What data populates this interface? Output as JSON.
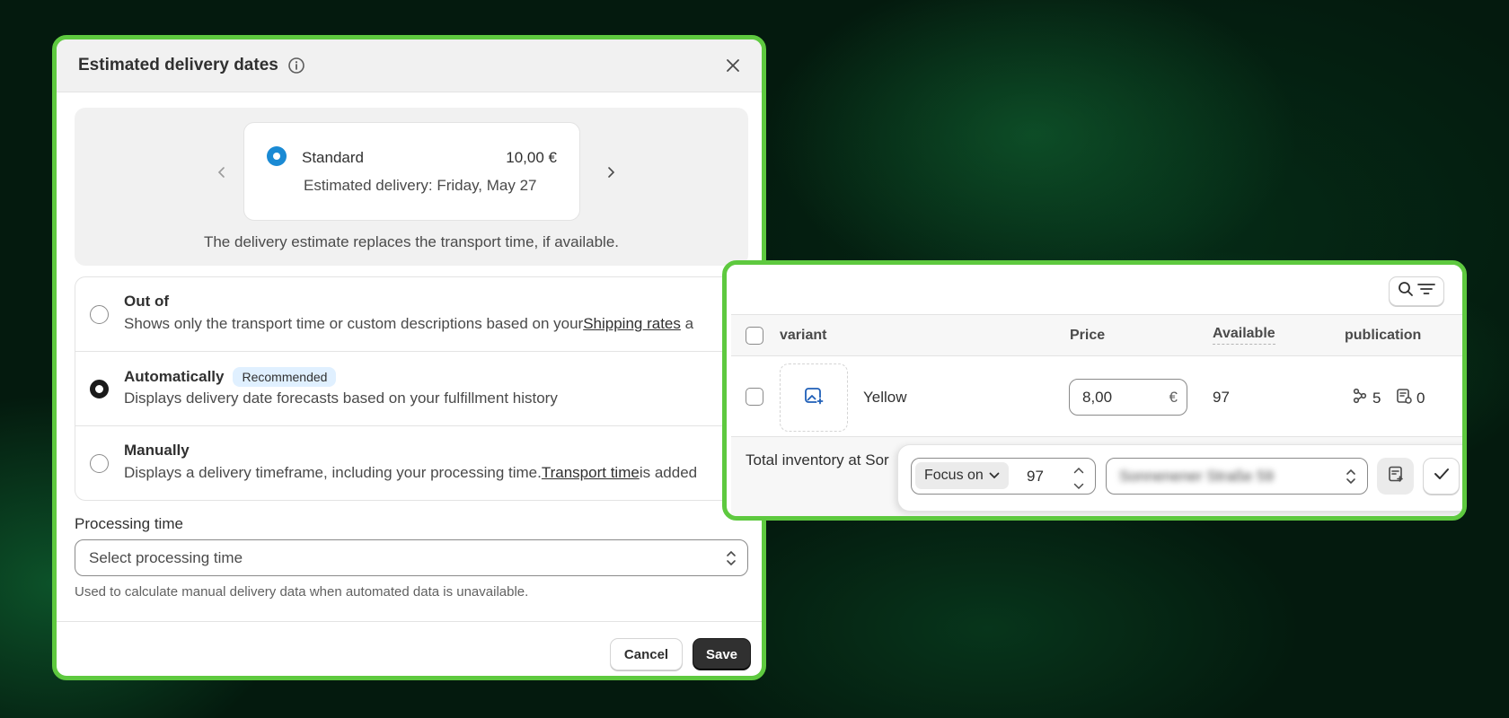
{
  "modal": {
    "title": "Estimated delivery dates",
    "preview": {
      "rate_name": "Standard",
      "rate_price": "10,00 €",
      "estimate": "Estimated delivery: Friday, May 27",
      "note": "The delivery estimate replaces the transport time, if available."
    },
    "options": [
      {
        "title": "Out of",
        "desc_before": "Shows only the transport time or custom descriptions based on your",
        "desc_link": "Shipping rates",
        "desc_after": " a",
        "selected": false
      },
      {
        "title": "Automatically",
        "badge": "Recommended",
        "desc": "Displays delivery date forecasts based on your fulfillment history",
        "selected": true
      },
      {
        "title": "Manually",
        "desc_before": "Displays a delivery timeframe, including your processing time.",
        "desc_link": "Transport time",
        "desc_after": "is added",
        "selected": false
      }
    ],
    "processing": {
      "label": "Processing time",
      "placeholder": "Select processing time",
      "help": "Used to calculate manual delivery data when automated data is unavailable."
    },
    "buttons": {
      "cancel": "Cancel",
      "save": "Save"
    }
  },
  "table": {
    "columns": {
      "variant": "variant",
      "price": "Price",
      "available": "Available",
      "publication": "publication"
    },
    "rows": [
      {
        "name": "Yellow",
        "price": "8,00",
        "currency": "€",
        "available": "97",
        "channels": "5",
        "catalogs": "0"
      }
    ],
    "total_text": "Total inventory at Sor",
    "focus": {
      "select_label": "Focus on",
      "value": "97",
      "location": "Sonnenener Straße 59"
    }
  },
  "colors": {
    "highlight": "#5ec93f",
    "radio_accent": "#1a8ad4",
    "badge_bg": "#e0f0ff"
  }
}
